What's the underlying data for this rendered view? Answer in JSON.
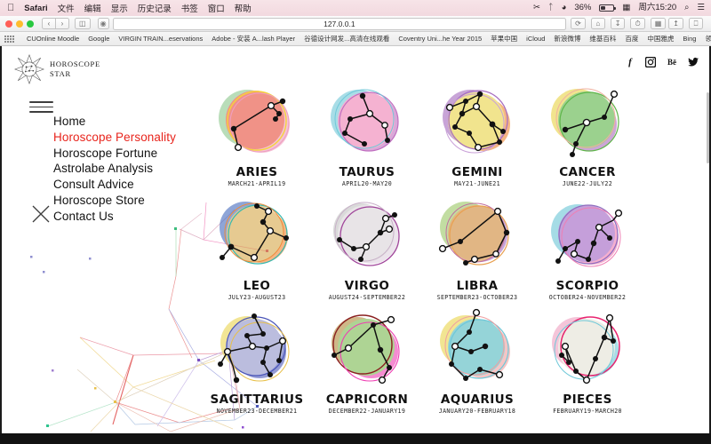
{
  "os": {
    "menubar": {
      "apple_logo": "apple-icon",
      "app_name": "Safari",
      "items": [
        "文件",
        "编辑",
        "显示",
        "历史记录",
        "书签",
        "窗口",
        "帮助"
      ],
      "status": {
        "scissors_icon": "scissors-icon",
        "bluetooth_icon": "bluetooth-icon",
        "wifi_icon": "wifi-icon",
        "battery_percent": "36%",
        "input_icon": "input-source-icon",
        "clock": "周六15:20",
        "search_icon": "spotlight-search-icon",
        "notification_icon": "notification-center-icon"
      }
    }
  },
  "browser": {
    "toolbar": {
      "back_label": "‹",
      "forward_label": "›",
      "sidebar_label": "sidebar-icon",
      "reader_label": "reader-icon",
      "url": "127.0.0.1",
      "reload_label": "⟳",
      "home_label": "home-icon",
      "downloads_label": "downloads-icon",
      "history_label": "history-icon",
      "topsites_label": "top-sites-icon",
      "share_label": "share-icon",
      "tabs_label": "tabs-icon"
    },
    "bookmarks": [
      "CUOnline Moodle",
      "Google",
      "VIRGIN TRAIN...eservations",
      "Adobe - 安装 A...lash Player",
      "谷德设计网发...高清在线观看",
      "Coventry Uni...he Year 2015",
      "苹果中国",
      "iCloud",
      "新浪微博",
      "维基百科",
      "百度",
      "中国雅虎",
      "Bing",
      "领英"
    ],
    "bookmarks_add": "+"
  },
  "site": {
    "logo": {
      "line1": "HOROSCOPE",
      "line2": "STAR",
      "mark": "star-burst-icon"
    },
    "social": [
      {
        "name": "facebook-icon",
        "glyph": "f"
      },
      {
        "name": "instagram-icon",
        "glyph": "◙"
      },
      {
        "name": "behance-icon",
        "glyph": "Bē"
      },
      {
        "name": "twitter-icon",
        "glyph": "🐦"
      }
    ],
    "menu_toggle": "hamburger-icon",
    "menu_close": "close-x-icon",
    "nav": [
      {
        "label": "Home",
        "active": false
      },
      {
        "label": "Horoscope Personality",
        "active": true
      },
      {
        "label": "Horoscope Fortune",
        "active": false
      },
      {
        "label": "Astrolabe Analysis",
        "active": false
      },
      {
        "label": "Consult Advice",
        "active": false
      },
      {
        "label": "Horoscope Store",
        "active": false
      },
      {
        "label": "Contact Us",
        "active": false
      }
    ],
    "active_color": "#e8241c",
    "signs": [
      {
        "name": "ARIES",
        "dates": "MARCH21-APRIL19",
        "fill": "#e8513f",
        "ring1": "#f5d43a",
        "ring2": "#ef9fc0",
        "ring3": "#8fc98f"
      },
      {
        "name": "TAURUS",
        "dates": "APRIL20-MAY20",
        "fill": "#ef7fb3",
        "ring1": "#c06fc0",
        "ring2": "#6fc8d8",
        "ring3": "#f0a0c8"
      },
      {
        "name": "GEMINI",
        "dates": "MAY21-JUNE21",
        "fill": "#ead44a",
        "ring1": "#a86fc0",
        "ring2": "#ef8b3a",
        "ring3": "#c9a0d8"
      },
      {
        "name": "CANCER",
        "dates": "JUNE22-JULY22",
        "fill": "#5fb64a",
        "ring1": "#ead44a",
        "ring2": "#b06fc0",
        "ring3": "#f0b0a0"
      },
      {
        "name": "LEO",
        "dates": "JULY23-AUGUST23",
        "fill": "#d7ab4e",
        "ring1": "#4a6fc0",
        "ring2": "#35b8b0",
        "ring3": "#ef8b3a"
      },
      {
        "name": "VIRGO",
        "dates": "AUGUST24-SEPTEMBER22",
        "fill": "#d8d2d6",
        "ring1": "#a0459a",
        "ring2": "#c0c0c0",
        "ring3": "#e0cfe0"
      },
      {
        "name": "LIBRA",
        "dates": "SEPTEMBER23-OCTOBER23",
        "fill": "#cf8b3a",
        "ring1": "#a86fc0",
        "ring2": "#9ec96a",
        "ring3": "#e8a050"
      },
      {
        "name": "SCORPIO",
        "dates": "OCTOBER24-NOVEMBER22",
        "fill": "#a265c4",
        "ring1": "#6fc8d8",
        "ring2": "#ef7fb3",
        "ring3": "#8f6fc0"
      },
      {
        "name": "SAGITTARIUS",
        "dates": "NOVEMBER23-DECEMBER21",
        "fill": "#8b8fc8",
        "ring1": "#4a55b8",
        "ring2": "#ead44a",
        "ring3": "#ef8b3a"
      },
      {
        "name": "CAPRICORN",
        "dates": "DECEMBER22-JANUARY19",
        "fill": "#79b84e",
        "ring1": "#8b2020",
        "ring2": "#ef3fb3",
        "ring3": "#b08a3a"
      },
      {
        "name": "AQUARIUS",
        "dates": "JANUARY20-FEBRUARY18",
        "fill": "#4fb8bf",
        "ring1": "#ead44a",
        "ring2": "#ef9fa0",
        "ring3": "#6fc8d8"
      },
      {
        "name": "PIECES",
        "dates": "FEBRUARY19-MARCH20",
        "fill": "#e4e2d4",
        "ring1": "#e8246f",
        "ring2": "#6fc8d8",
        "ring3": "#ef9fc0"
      }
    ]
  }
}
